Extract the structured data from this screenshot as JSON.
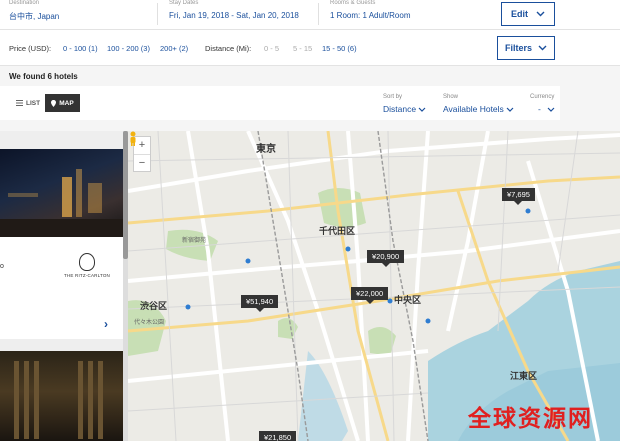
{
  "search": {
    "destination_label": "Destination",
    "destination": "台中市, Japan",
    "dates_label": "Stay Dates",
    "dates": "Fri, Jan 19, 2018 - Sat, Jan 20, 2018",
    "rooms_label": "Rooms & Guests",
    "rooms": "1 Room: 1 Adult/Room",
    "edit_label": "Edit"
  },
  "filters": {
    "price_label": "Price (USD):",
    "price_options": [
      "0 - 100 (1)",
      "100 - 200 (3)",
      "200+ (2)"
    ],
    "distance_label": "Distance (Mi):",
    "distance_options": [
      "0 - 5",
      "5 - 15",
      "15 - 50 (6)"
    ],
    "filters_label": "Filters"
  },
  "results": {
    "found_text": "We found 6 hotels"
  },
  "view": {
    "list_label": "LIST",
    "map_label": "MAP"
  },
  "controls": {
    "sort_label": "Sort by",
    "sort_value": "Distance",
    "show_label": "Show",
    "show_value": "Available Hotels",
    "currency_label": "Currency",
    "currency_value": "-"
  },
  "hotel_list": {
    "card1_brand": "THE RITZ-CARLTON",
    "card1_text": "o"
  },
  "map": {
    "places": {
      "tokyo": "東京",
      "chiyoda": "千代田区",
      "chuo": "中央区",
      "shibuya": "渋谷区",
      "koto": "江東区",
      "shinjuku_gyoen": "新宿御苑",
      "yoyogi": "代々木公園"
    },
    "markers": [
      "¥7,695",
      "¥20,900",
      "¥22,000",
      "¥51,940",
      "¥21,850"
    ],
    "watermark": "全球资源网"
  },
  "colors": {
    "accent": "#1a4f9c",
    "marker": "#333333",
    "watermark": "#e02020"
  }
}
